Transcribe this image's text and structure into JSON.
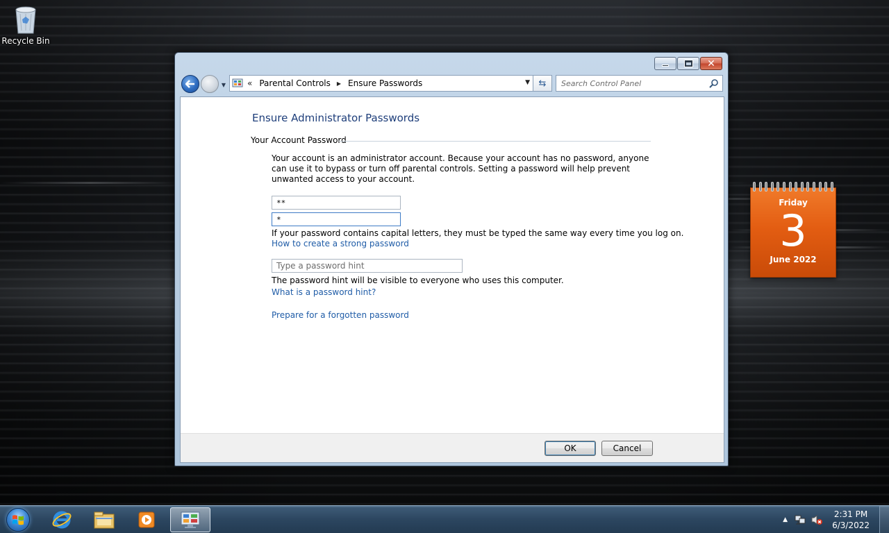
{
  "desktop": {
    "recycle_bin_label": "Recycle Bin",
    "calendar": {
      "weekday": "Friday",
      "day": "3",
      "month_year": "June 2022"
    }
  },
  "window": {
    "address": {
      "breadcrumbs": [
        "Parental Controls",
        "Ensure Passwords"
      ]
    },
    "search": {
      "placeholder": "Search Control Panel"
    },
    "page_title": "Ensure Administrator Passwords",
    "section_label": "Your Account Password",
    "description": "Your account is an administrator account. Because your account has no password, anyone can use it to bypass or turn off parental controls. Setting a password will help prevent unwanted access to your account.",
    "password_value": "**",
    "confirm_value": "*",
    "capital_note": "If your password contains capital letters, they must be typed the same way every time you log on.",
    "strong_password_link": "How to create a strong password",
    "hint": {
      "placeholder": "Type a password hint",
      "value": ""
    },
    "hint_note": "The password hint will be visible to everyone who uses this computer.",
    "what_hint_link": "What is a password hint?",
    "forgotten_link": "Prepare for a forgotten password",
    "ok_label": "OK",
    "cancel_label": "Cancel"
  },
  "taskbar": {
    "clock_time": "2:31 PM",
    "clock_date": "6/3/2022",
    "pinned": [
      "internet-explorer-icon",
      "windows-explorer-icon",
      "media-player-icon",
      "control-panel-icon"
    ]
  },
  "colors": {
    "title": "#1e3e7a",
    "link": "#1f5ca7",
    "calendar": "#e35d12"
  }
}
